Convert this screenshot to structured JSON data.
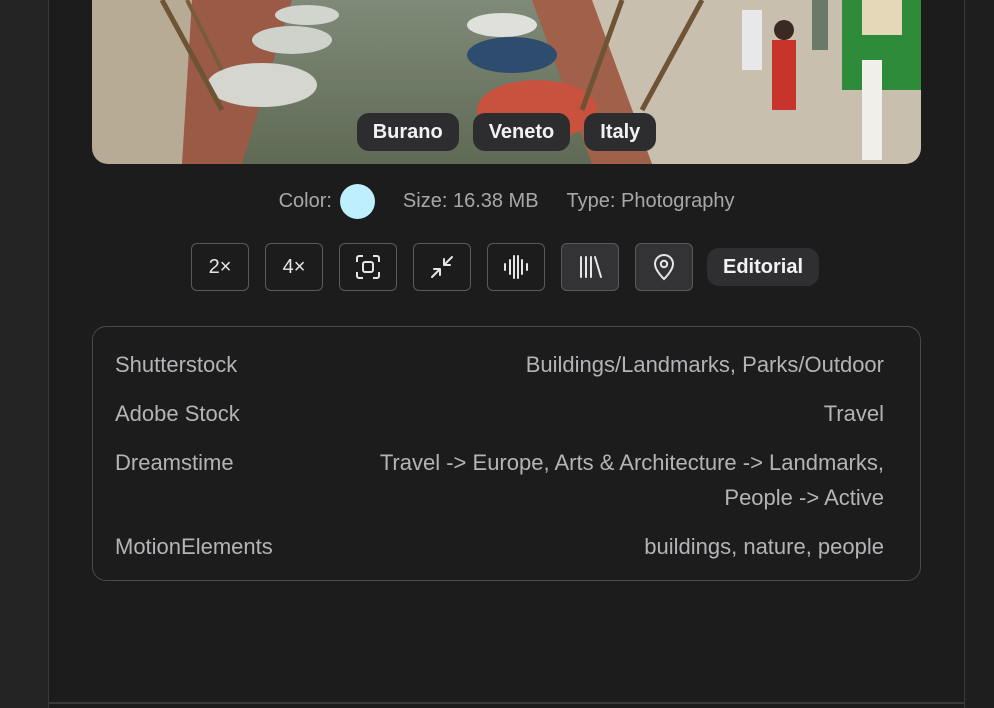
{
  "photo": {
    "tags": [
      "Burano",
      "Veneto",
      "Italy"
    ]
  },
  "meta": {
    "color_label": "Color:",
    "color_value": "#bdefff",
    "size_text": "Size: 16.38 MB",
    "type_text": "Type: Photography"
  },
  "tools": {
    "upscale_2x": "2×",
    "upscale_4x": "4×",
    "editorial": "Editorial"
  },
  "categories": [
    {
      "site": "Shutterstock",
      "value": "Buildings/Landmarks, Parks/Outdoor"
    },
    {
      "site": "Adobe Stock",
      "value": "Travel"
    },
    {
      "site": "Dreamstime",
      "value_line1": "Travel -> Europe, Arts & Architecture -> Landmarks,",
      "value_line2": "People -> Active"
    },
    {
      "site": "MotionElements",
      "value": "buildings, nature, people"
    }
  ]
}
